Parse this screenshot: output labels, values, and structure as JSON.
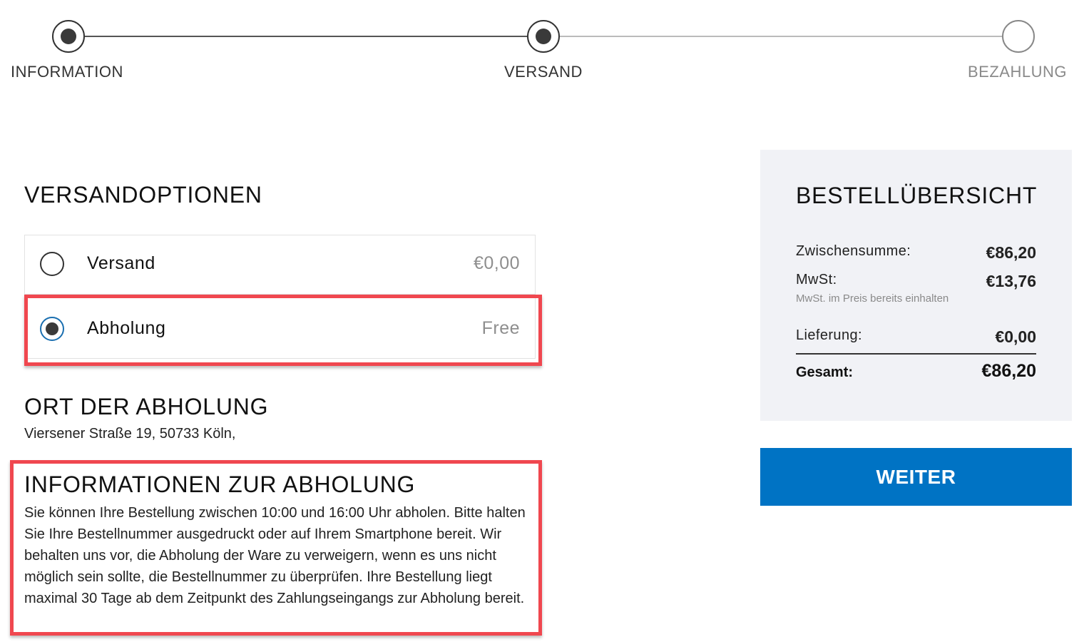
{
  "stepper": {
    "steps": [
      {
        "label": "INFORMATION",
        "state": "done"
      },
      {
        "label": "VERSAND",
        "state": "current"
      },
      {
        "label": "BEZAHLUNG",
        "state": "pending"
      }
    ]
  },
  "shipping": {
    "title": "VERSANDOPTIONEN",
    "options": [
      {
        "label": "Versand",
        "price": "€0,00",
        "selected": false
      },
      {
        "label": "Abholung",
        "price": "Free",
        "selected": true
      }
    ]
  },
  "pickup_location": {
    "title": "ORT DER ABHOLUNG",
    "address": "Viersener Straße 19, 50733 Köln,"
  },
  "pickup_info": {
    "title": "INFORMATIONEN ZUR ABHOLUNG",
    "text": "Sie können Ihre Bestellung zwischen 10:00 und 16:00 Uhr abholen. Bitte halten Sie Ihre Bestellnummer ausgedruckt oder auf Ihrem Smartphone bereit. Wir behalten uns vor, die Abholung der Ware zu verweigern, wenn es uns nicht möglich sein sollte, die Bestellnummer zu überprüfen. Ihre Bestellung liegt maximal 30 Tage ab dem Zeitpunkt des Zahlungseingangs zur Abholung bereit."
  },
  "summary": {
    "title": "BESTELLÜBERSICHT",
    "subtotal_label": "Zwischensumme:",
    "subtotal_value": "€86,20",
    "vat_label": "MwSt:",
    "vat_value": "€13,76",
    "vat_note": "MwSt. im Preis bereits einhalten",
    "delivery_label": "Lieferung:",
    "delivery_value": "€0,00",
    "total_label": "Gesamt:",
    "total_value": "€86,20"
  },
  "actions": {
    "next_label": "WEITER"
  },
  "colors": {
    "accent": "#0073c4",
    "highlight": "#f0474f",
    "summary_bg": "#f1f2f6"
  }
}
